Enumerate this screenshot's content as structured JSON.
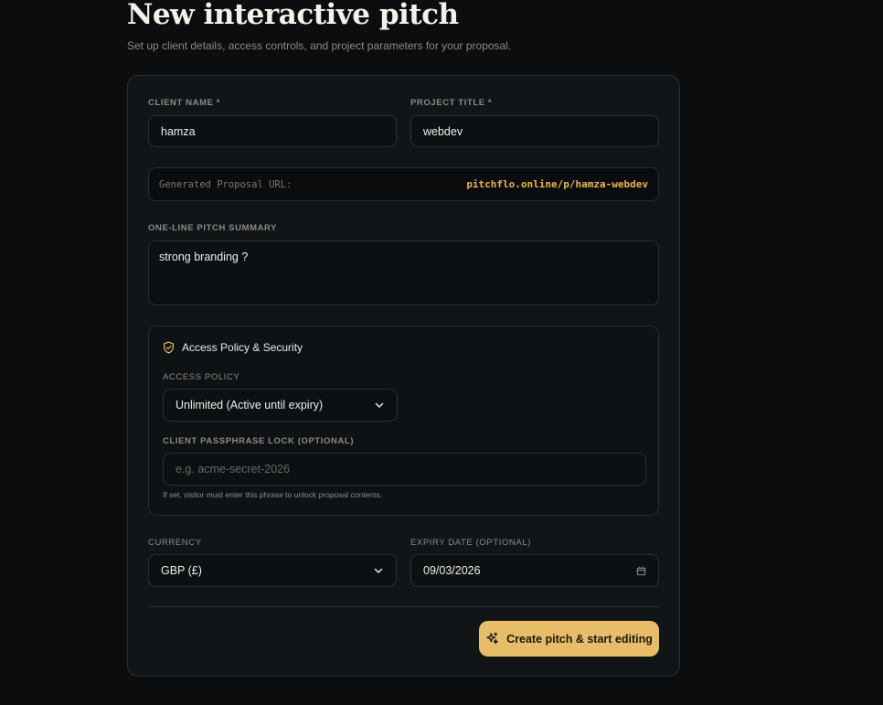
{
  "header": {
    "title": "New interactive pitch",
    "subtitle": "Set up client details, access controls, and project parameters for your proposal."
  },
  "form": {
    "client_name": {
      "label": "CLIENT NAME *",
      "value": "hamza"
    },
    "project_title": {
      "label": "PROJECT TITLE *",
      "value": "webdev"
    },
    "url": {
      "prefix": "Generated Proposal URL:",
      "value": "pitchflo.online/p/hamza-webdev"
    },
    "summary": {
      "label": "ONE-LINE PITCH SUMMARY",
      "value": "strong branding ?"
    },
    "security": {
      "title": "Access Policy & Security",
      "policy_label": "ACCESS POLICY",
      "policy_value": "Unlimited (Active until expiry)",
      "passphrase_label": "CLIENT PASSPHRASE LOCK (OPTIONAL)",
      "passphrase_placeholder": "e.g. acme-secret-2026",
      "helper": "If set, visitor must enter this phrase to unlock proposal contents."
    },
    "currency": {
      "label": "CURRENCY",
      "value": "GBP (£)"
    },
    "expiry": {
      "label": "EXPIRY DATE (OPTIONAL)",
      "value": "09/03/2026"
    },
    "submit_label": "Create pitch & start editing"
  },
  "icons": {
    "shield": "shield-check-icon",
    "chevron": "chevron-down-icon",
    "calendar": "calendar-icon",
    "sparkles": "sparkles-icon"
  },
  "colors": {
    "accent": "#e7bd6a",
    "url_accent": "#e9b55a",
    "background": "#0c0d0f",
    "card": "#121518"
  }
}
